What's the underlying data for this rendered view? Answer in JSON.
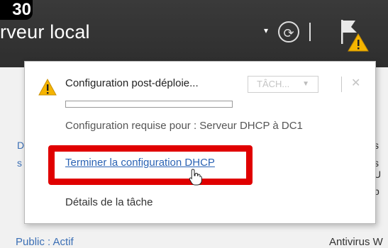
{
  "step_number": "30",
  "header": {
    "title": "rveur local",
    "dropdown_glyph": "▾",
    "refresh_glyph": "⟳"
  },
  "background": {
    "left_frag_1": "D",
    "left_frag_2": "s",
    "right_frag_1": "s",
    "right_frag_2": "s U",
    "right_frag_3": "p",
    "bottom_left": "Public : Actif",
    "bottom_right": "Antivirus W"
  },
  "notification": {
    "title": "Configuration post-déploie...",
    "tasks_dropdown": "TÂCH...",
    "close_glyph": "✕",
    "progress_fraction": 0.0,
    "description": "Configuration requise pour : Serveur DHCP à DC1",
    "link": "Terminer la configuration DHCP",
    "details": "Détails de la tâche"
  },
  "colors": {
    "highlight": "#e00000",
    "link": "#2b63b4",
    "warning": "#f5b400",
    "header_bg": "#333333"
  },
  "icons": [
    "warning-icon",
    "refresh-icon",
    "flag-icon",
    "hand-cursor-icon"
  ]
}
